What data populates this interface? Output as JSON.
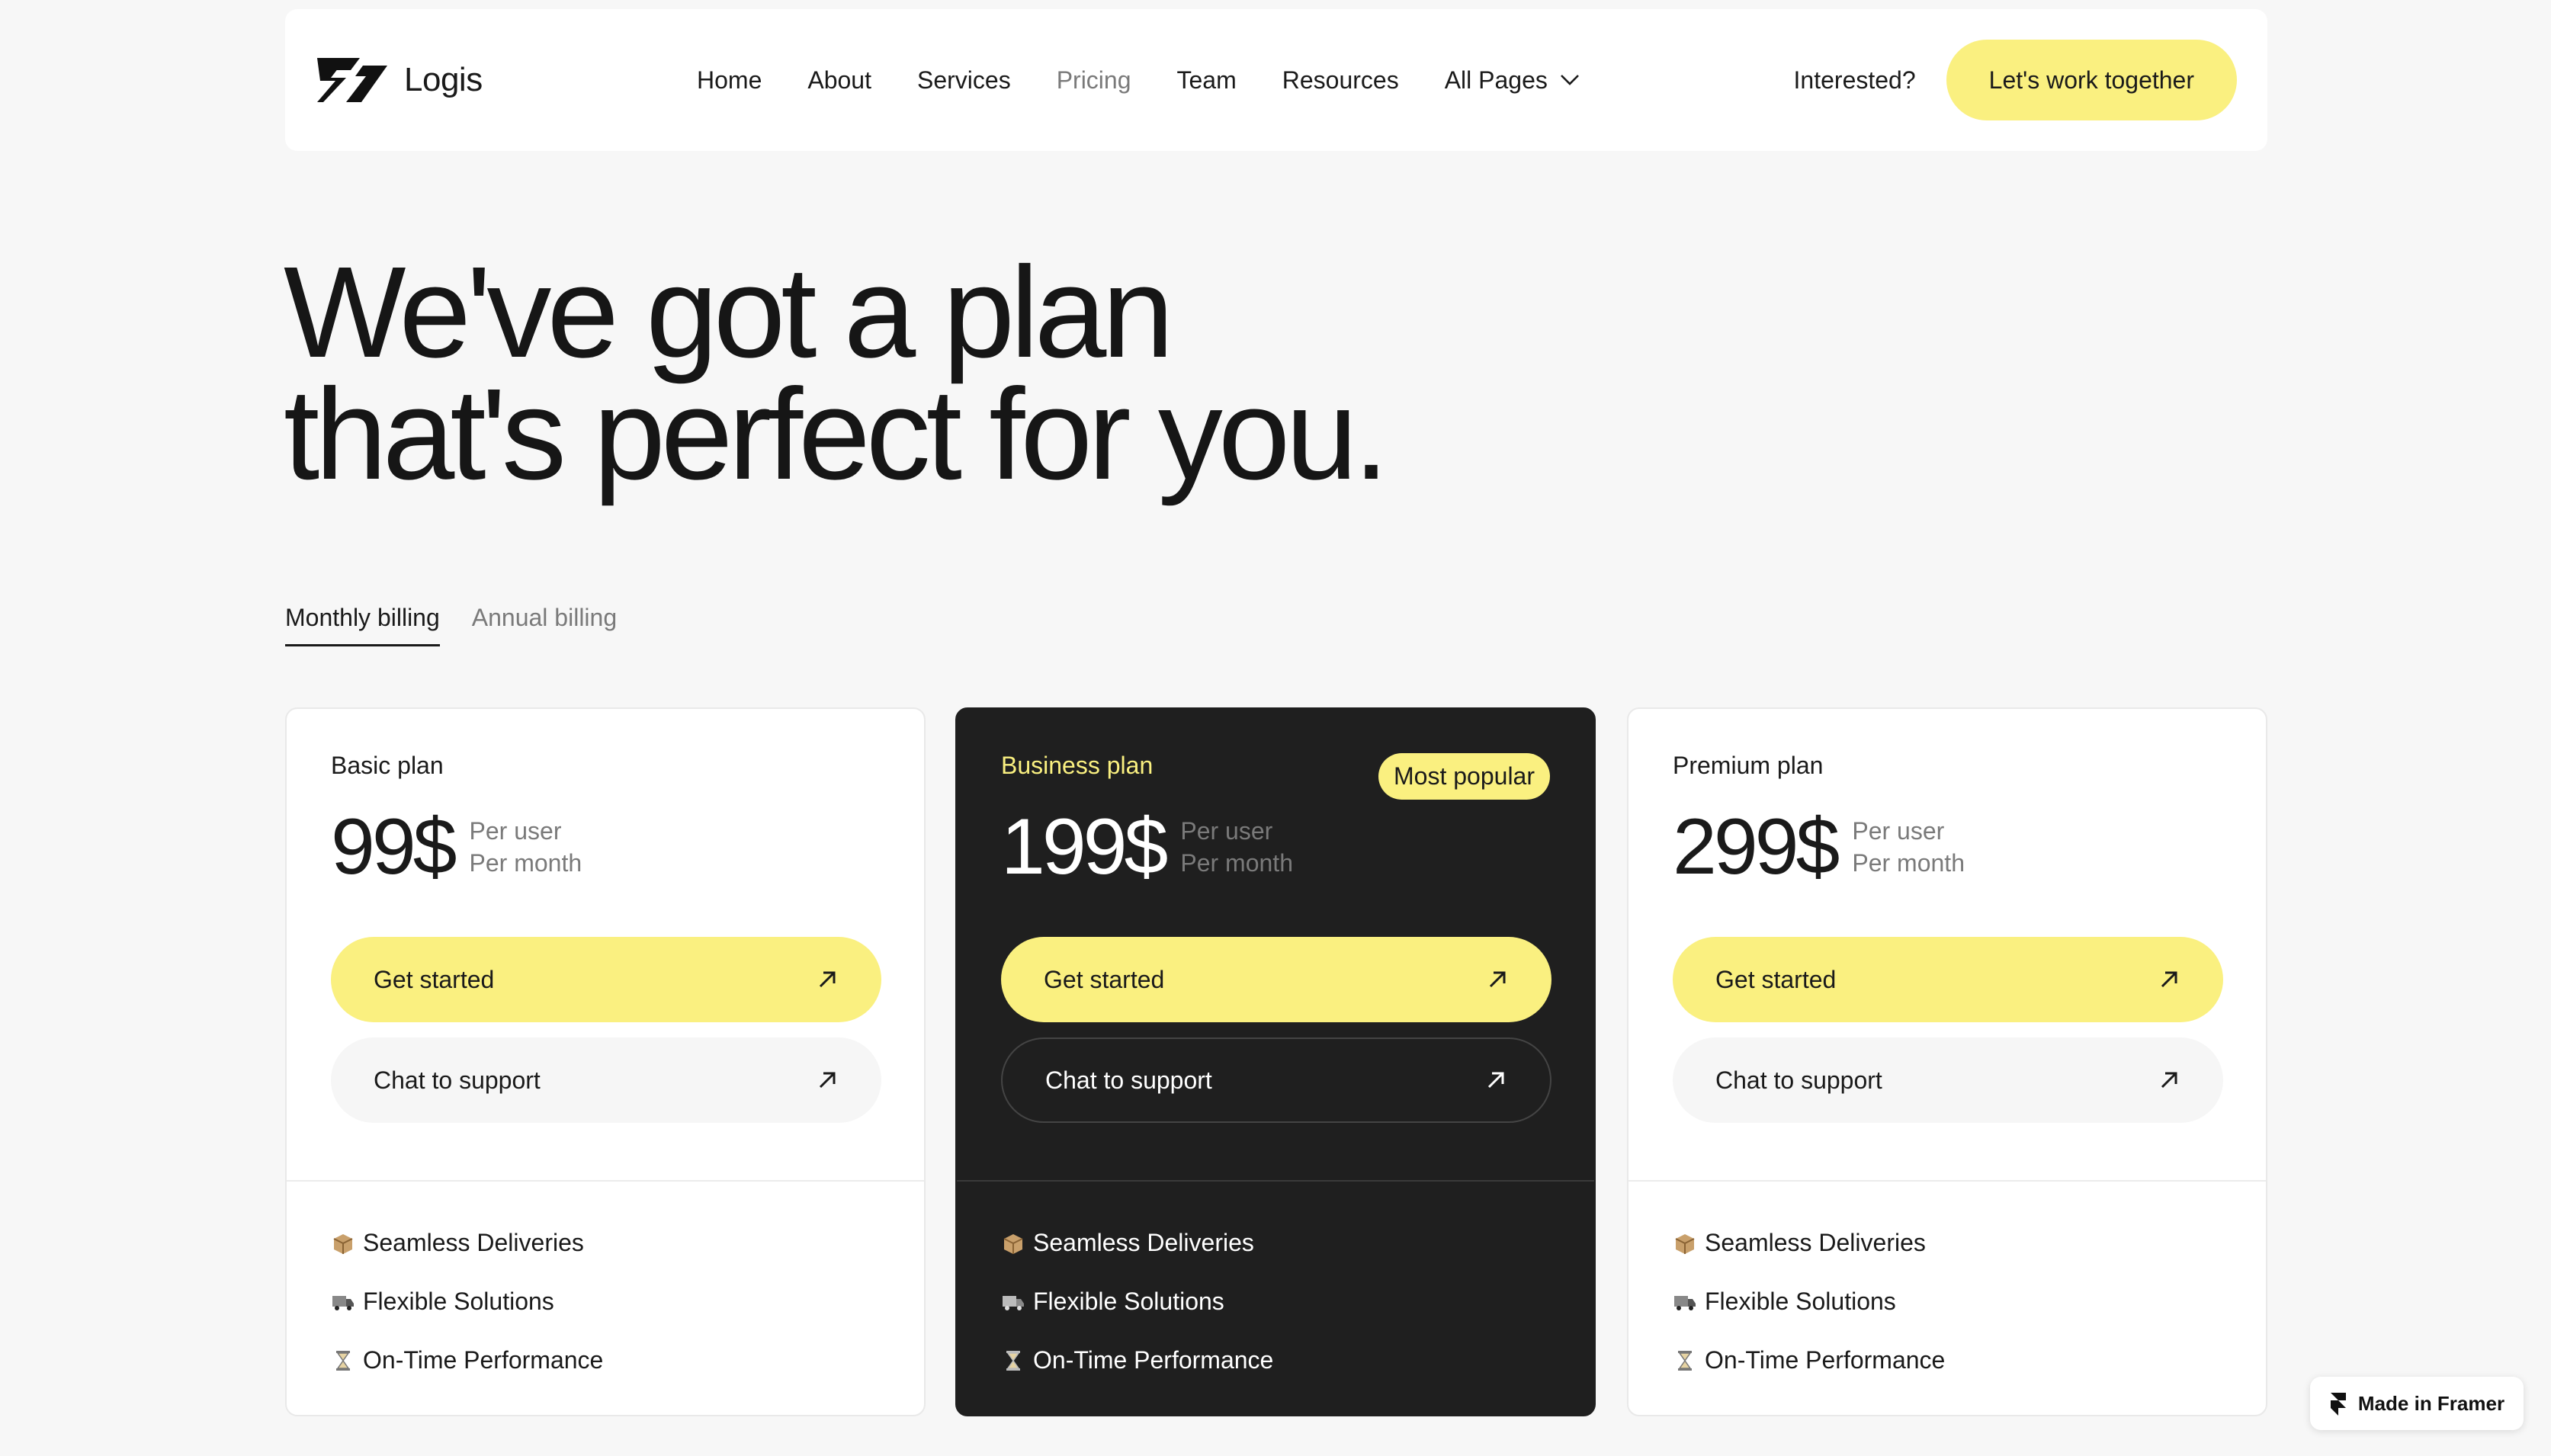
{
  "brand": {
    "name": "Logis"
  },
  "nav": {
    "links": [
      "Home",
      "About",
      "Services",
      "Pricing",
      "Team",
      "Resources"
    ],
    "dropdown_label": "All Pages",
    "active": "Pricing",
    "interested": "Interested?",
    "cta": "Let's work together"
  },
  "hero": {
    "line1": "We've got a plan",
    "line2": "that's perfect for you."
  },
  "billing": {
    "tabs": [
      "Monthly billing",
      "Annual billing"
    ],
    "active": "Monthly billing"
  },
  "plans": [
    {
      "name": "Basic plan",
      "price": "99$",
      "per1": "Per user",
      "per2": "Per month",
      "primary": "Get started",
      "secondary": "Chat to support",
      "features": [
        "Seamless Deliveries",
        "Flexible Solutions",
        "On-Time Performance"
      ]
    },
    {
      "name": "Business plan",
      "badge": "Most popular",
      "price": "199$",
      "per1": "Per user",
      "per2": "Per month",
      "primary": "Get started",
      "secondary": "Chat to support",
      "features": [
        "Seamless Deliveries",
        "Flexible Solutions",
        "On-Time Performance"
      ]
    },
    {
      "name": "Premium plan",
      "price": "299$",
      "per1": "Per user",
      "per2": "Per month",
      "primary": "Get started",
      "secondary": "Chat to support",
      "features": [
        "Seamless Deliveries",
        "Flexible Solutions",
        "On-Time Performance"
      ]
    }
  ],
  "feature_icons": [
    "package-icon",
    "truck-icon",
    "hourglass-icon"
  ],
  "framer_badge": "Made in Framer",
  "colors": {
    "accent": "#faf080",
    "dark_card": "#1f1f1f",
    "background": "#f7f7f7"
  }
}
